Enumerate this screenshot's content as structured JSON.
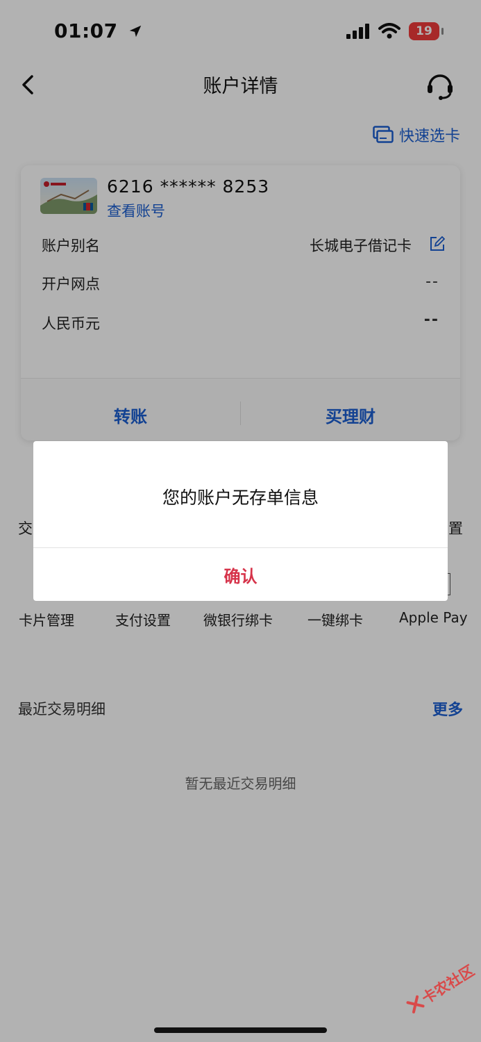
{
  "status_bar": {
    "time": "01:07",
    "battery": "19",
    "icons": [
      "location-arrow-icon",
      "cellular-signal-icon",
      "wifi-icon"
    ]
  },
  "nav": {
    "title": "账户详情",
    "back_icon": "chevron-left-icon",
    "service_icon": "headset-icon"
  },
  "quick_pick": {
    "label": "快速选卡",
    "icon": "card-switch-icon"
  },
  "card": {
    "number": "6216 ****** 8253",
    "view_number": "查看账号",
    "rows": [
      {
        "label": "账户别名",
        "value": "长城电子借记卡"
      },
      {
        "label": "开户网点",
        "value": "--"
      },
      {
        "label": "人民币元",
        "value": "--"
      }
    ],
    "actions": [
      "转账",
      "买理财"
    ]
  },
  "background": {
    "partial_left": "交",
    "partial_right": "置",
    "shortcuts": [
      "卡片管理",
      "支付设置",
      "微银行绑卡",
      "一键绑卡",
      "Apple Pay"
    ],
    "section_title": "最近交易明细",
    "more": "更多",
    "empty": "暂无最近交易明细"
  },
  "dialog": {
    "message": "您的账户无存单信息",
    "confirm": "确认"
  },
  "colors": {
    "accent": "#1c5fd1",
    "confirm": "#d6334a",
    "battery": "#ef3b3b"
  }
}
